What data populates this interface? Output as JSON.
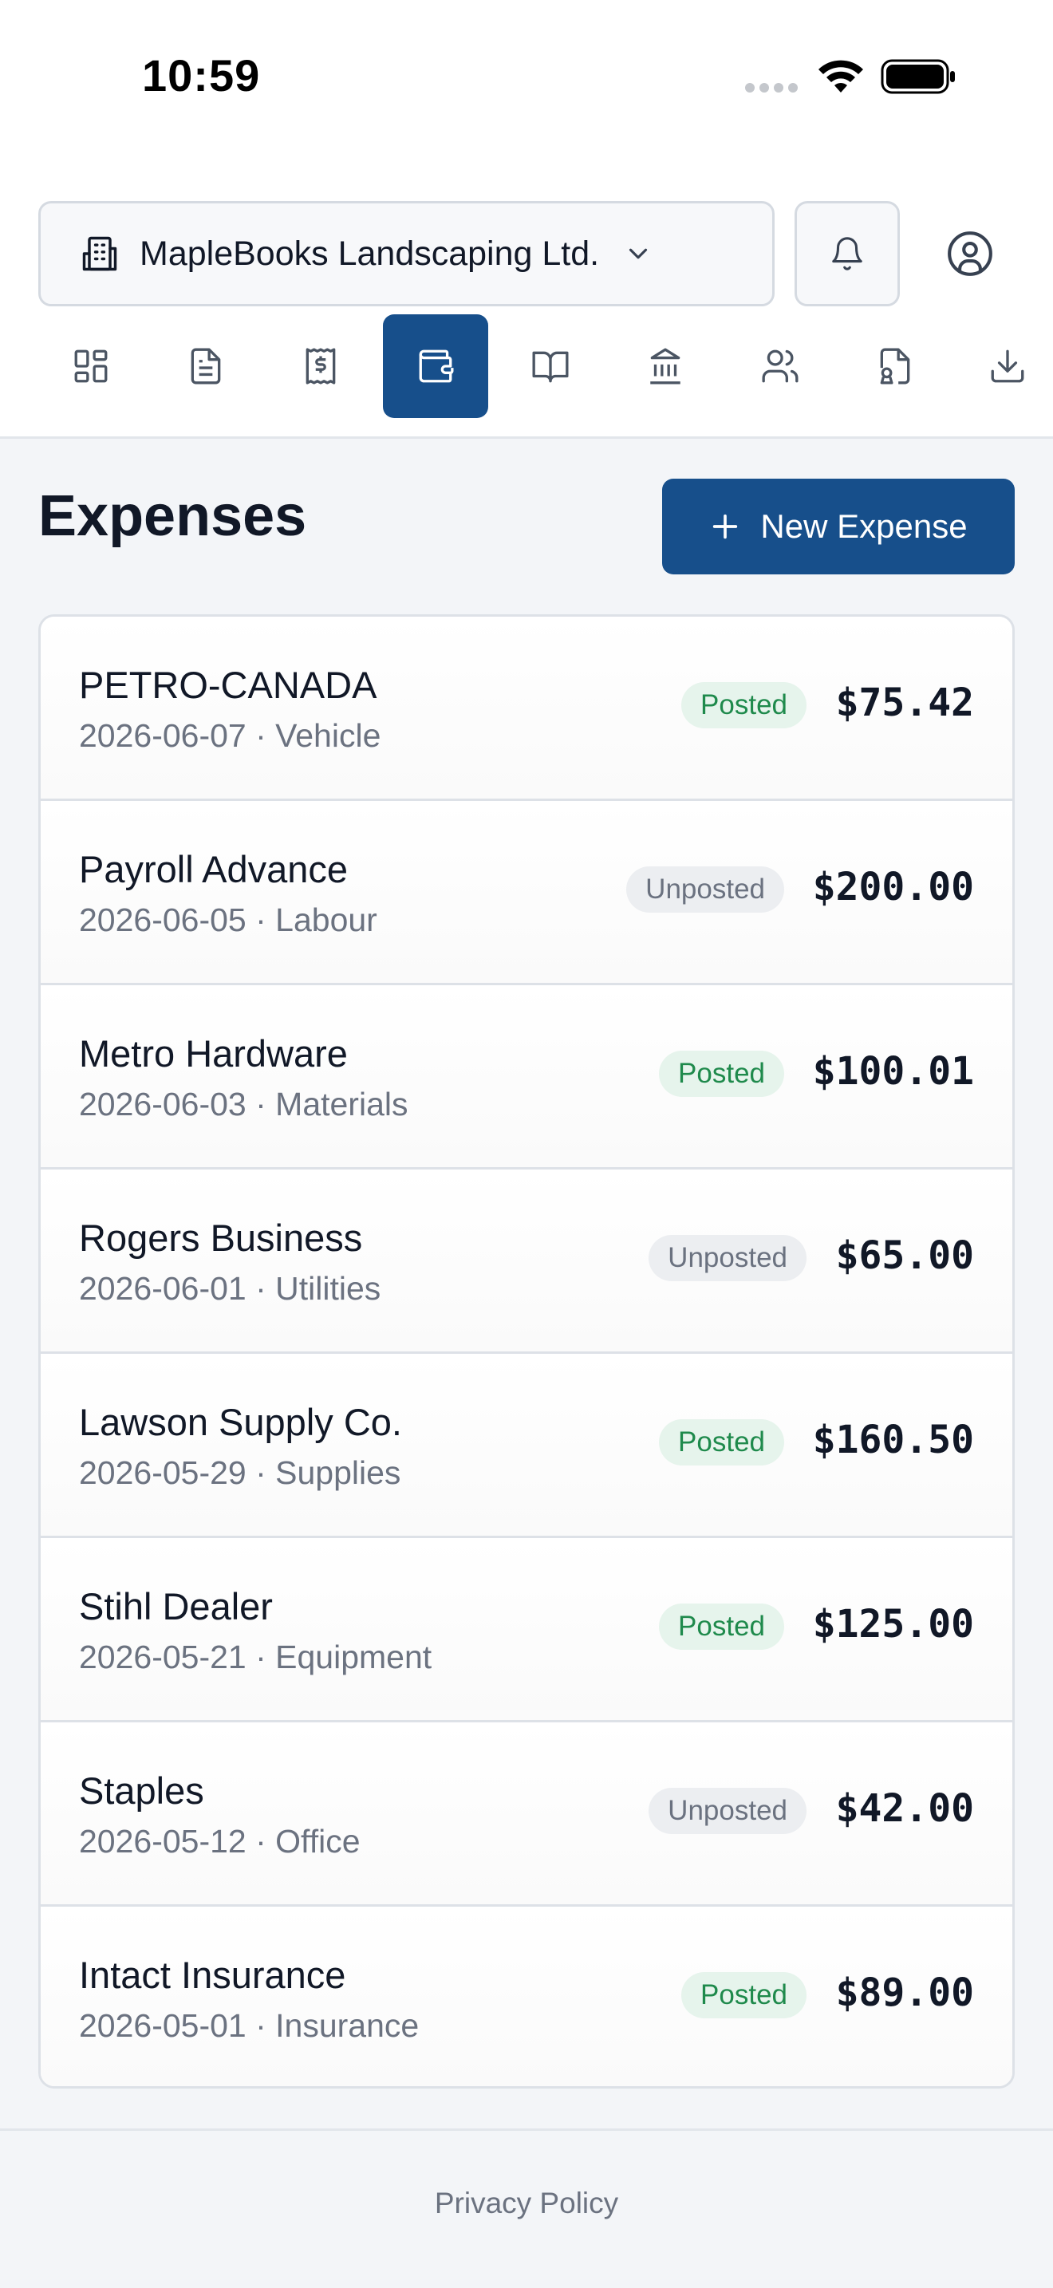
{
  "status_bar": {
    "time": "10:59"
  },
  "header": {
    "company_name": "MapleBooks Landscaping Ltd."
  },
  "nav": {
    "items": [
      {
        "icon": "dashboard-icon",
        "active": false
      },
      {
        "icon": "document-icon",
        "active": false
      },
      {
        "icon": "receipt-icon",
        "active": false
      },
      {
        "icon": "wallet-icon",
        "active": true
      },
      {
        "icon": "book-icon",
        "active": false
      },
      {
        "icon": "bank-icon",
        "active": false
      },
      {
        "icon": "users-icon",
        "active": false
      },
      {
        "icon": "tax-file-icon",
        "active": false
      },
      {
        "icon": "download-icon",
        "active": false
      }
    ]
  },
  "page": {
    "title": "Expenses",
    "new_button_label": "New Expense"
  },
  "expenses": [
    {
      "vendor": "PETRO-CANADA",
      "meta": "2026-06-07 · Vehicle",
      "status": "Posted",
      "amount": "$75.42"
    },
    {
      "vendor": "Payroll Advance",
      "meta": "2026-06-05 · Labour",
      "status": "Unposted",
      "amount": "$200.00"
    },
    {
      "vendor": "Metro Hardware",
      "meta": "2026-06-03 · Materials",
      "status": "Posted",
      "amount": "$100.01"
    },
    {
      "vendor": "Rogers Business",
      "meta": "2026-06-01 · Utilities",
      "status": "Unposted",
      "amount": "$65.00"
    },
    {
      "vendor": "Lawson Supply Co.",
      "meta": "2026-05-29 · Supplies",
      "status": "Posted",
      "amount": "$160.50"
    },
    {
      "vendor": "Stihl Dealer",
      "meta": "2026-05-21 · Equipment",
      "status": "Posted",
      "amount": "$125.00"
    },
    {
      "vendor": "Staples",
      "meta": "2026-05-12 · Office",
      "status": "Unposted",
      "amount": "$42.00"
    },
    {
      "vendor": "Intact Insurance",
      "meta": "2026-05-01 · Insurance",
      "status": "Posted",
      "amount": "$89.00"
    }
  ],
  "footer": {
    "privacy_label": "Privacy Policy"
  },
  "colors": {
    "primary": "#174f8b",
    "posted_bg": "#e6f4ec",
    "posted_text": "#1f8a4c",
    "unposted_bg": "#eceef1",
    "unposted_text": "#6b7280"
  }
}
